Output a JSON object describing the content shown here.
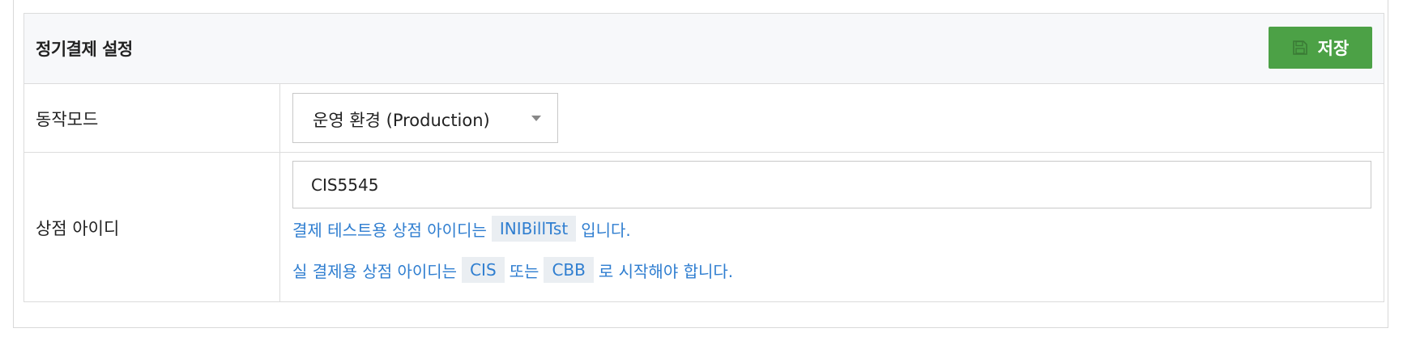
{
  "panel": {
    "title": "정기결제 설정",
    "save_label": "저장",
    "save_icon": "floppy-disk-icon"
  },
  "mode_row": {
    "label": "동작모드",
    "selected": "운영 환경 (Production)"
  },
  "merchant_row": {
    "label": "상점 아이디",
    "value": "CIS5545",
    "help1": {
      "prefix": "결제 테스트용 상점 아이디는",
      "code": "INIBillTst",
      "suffix": "입니다."
    },
    "help2": {
      "prefix": "실 결제용 상점 아이디는",
      "code1": "CIS",
      "middle": "또는",
      "code2": "CBB",
      "suffix": "로 시작해야 합니다."
    }
  },
  "colors": {
    "save_button": "#4ca146",
    "help_text": "#2f7ed0",
    "header_bg": "#f7f8fa"
  }
}
